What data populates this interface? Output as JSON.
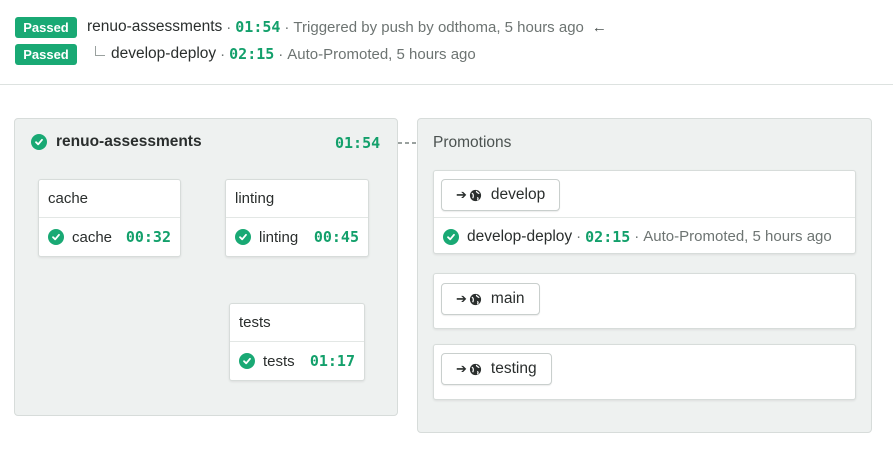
{
  "header": {
    "pipeline": {
      "status": "Passed",
      "name": "renuo-assessments",
      "duration": "01:54",
      "trigger_text": "Triggered by push by odthoma, 5 hours ago",
      "back_icon": "arrow-left-icon"
    },
    "promotion": {
      "status": "Passed",
      "name": "develop-deploy",
      "duration": "02:15",
      "trigger_text": "Auto-Promoted, 5 hours ago"
    }
  },
  "workflow": {
    "name": "renuo-assessments",
    "duration": "01:54",
    "blocks": [
      {
        "title": "cache",
        "job": "cache",
        "duration": "00:32"
      },
      {
        "title": "linting",
        "job": "linting",
        "duration": "00:45"
      },
      {
        "title": "tests",
        "job": "tests",
        "duration": "01:17"
      }
    ]
  },
  "promotions": {
    "title": "Promotions",
    "items": [
      {
        "label": "develop",
        "run": {
          "name": "develop-deploy",
          "duration": "02:15",
          "trigger_text": "Auto-Promoted, 5 hours ago"
        }
      },
      {
        "label": "main"
      },
      {
        "label": "testing"
      }
    ]
  },
  "colors": {
    "accent": "#19a974",
    "time": "#13a06b",
    "panel_bg": "#eef1f0",
    "connector": "#9aaca6"
  }
}
